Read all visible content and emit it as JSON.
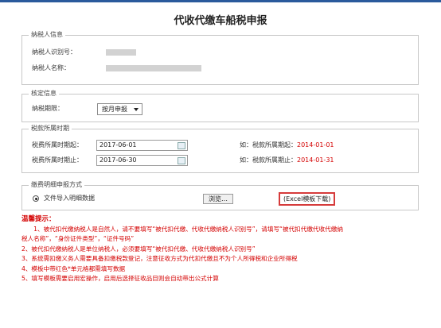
{
  "page": {
    "title": "代收代缴车船税申报"
  },
  "taxpayer": {
    "legend": "纳税人信息",
    "id_label": "纳税人识别号：",
    "name_label": "纳税人名称："
  },
  "verify": {
    "legend": "核定信息",
    "period_label": "纳税期限：",
    "period_value": "按月申报"
  },
  "tax_period": {
    "legend": "税款所属时期",
    "start_label": "税费所属时期起：",
    "start_value": "2017-06-01",
    "end_label": "税费所属时期止：",
    "end_value": "2017-06-30",
    "start_example_prefix": "如：税款所属期起：",
    "start_example_value": "2014-01-01",
    "end_example_prefix": "如：税款所属期止：",
    "end_example_value": "2014-01-31"
  },
  "method": {
    "legend": "缴费明细申报方式",
    "option_label": "文件导入明细数据",
    "browse_label": "浏览…",
    "excel_label": "(Excel模板下载)"
  },
  "tips": {
    "title": "温馨提示：",
    "line1": "　　1、被代扣代缴纳税人是自然人，请不要填写“被代扣代缴、代收代缴纳税人识别号”，请填写“被代扣代缴代收代缴纳",
    "line1b": "税人名称”，“身份证件类型”，“证件号码”",
    "line2": "2、被代扣代缴纳税人是单位纳税人，必须要填写“被代扣代缴、代收代缴纳税人识别号”",
    "line3": "3、系统需扣缴义务人需要具备扣缴税款登记，注意征收方式为代扣代缴且不为个人所得税和企业所得税",
    "line4": "4、模板中带红色*单元格都需填写数据",
    "line5": "5、填写模板需要启用宏操作，启用后选择征收品目则会自动带出公式计算"
  },
  "colors": {
    "accent": "#2a5a9c",
    "tip_red": "#d40000",
    "excel_border": "#d63b3b"
  }
}
